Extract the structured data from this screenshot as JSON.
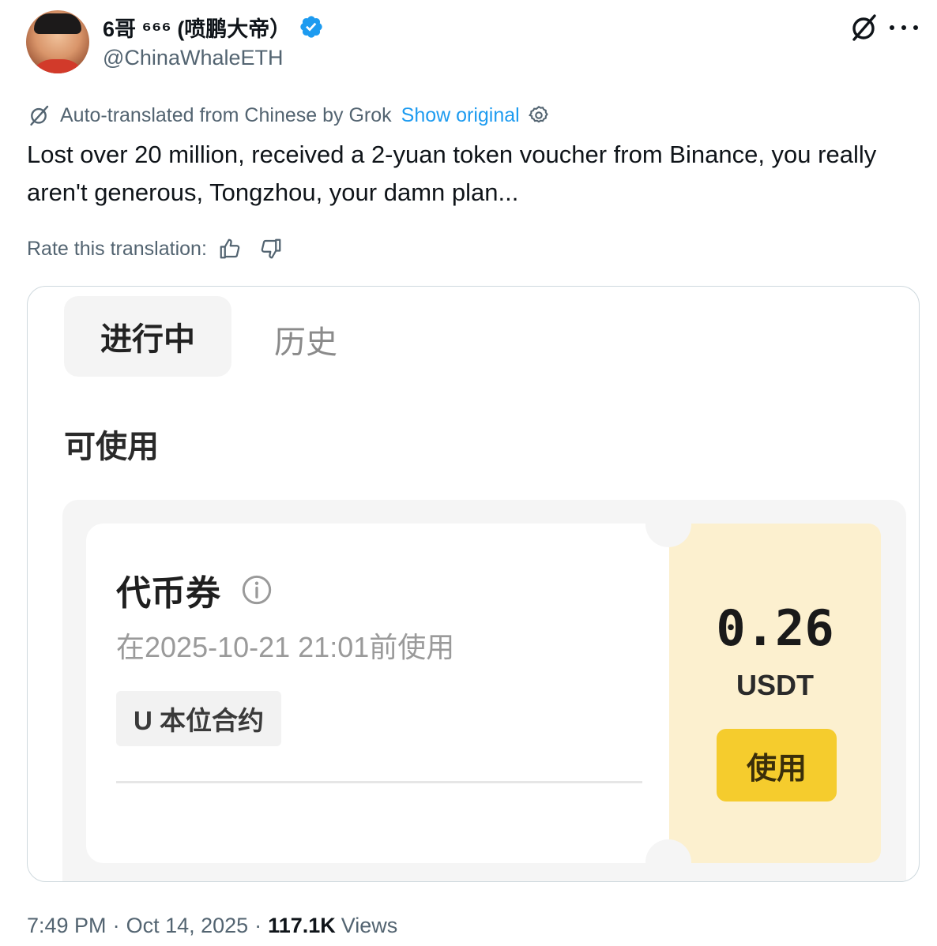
{
  "tweet": {
    "display_name": "6哥 ⁶⁶⁶ (喷鹏大帝）",
    "handle": "@ChinaWhaleETH",
    "auto_translated": "Auto-translated from Chinese by Grok",
    "show_original": "Show original",
    "text": "Lost over 20 million, received a 2-yuan token voucher from Binance, you really aren't generous, Tongzhou, your damn plan...",
    "rate_label": "Rate this translation:",
    "time": "7:49 PM",
    "sep1": "·",
    "date": "Oct 14, 2025",
    "sep2": "·",
    "views_count": "117.1K",
    "views_label": "Views"
  },
  "media": {
    "tabs": [
      "进行中",
      "历史"
    ],
    "section_label": "可使用",
    "coupon": {
      "title": "代币券",
      "expiry": "在2025-10-21 21:01前使用",
      "tag": "U 本位合约",
      "amount": "0.26",
      "unit": "USDT",
      "use_label": "使用"
    }
  },
  "colors": {
    "link": "#1d9bf0",
    "verified": "#1d9bf0",
    "secondary_text": "#536471",
    "coupon_accent": "#f5cc2d",
    "coupon_panel": "#fcf0cf"
  },
  "icons": [
    "verified-badge-icon",
    "grok-icon",
    "more-icon",
    "settings-icon",
    "thumbs-up-icon",
    "thumbs-down-icon",
    "info-icon"
  ]
}
